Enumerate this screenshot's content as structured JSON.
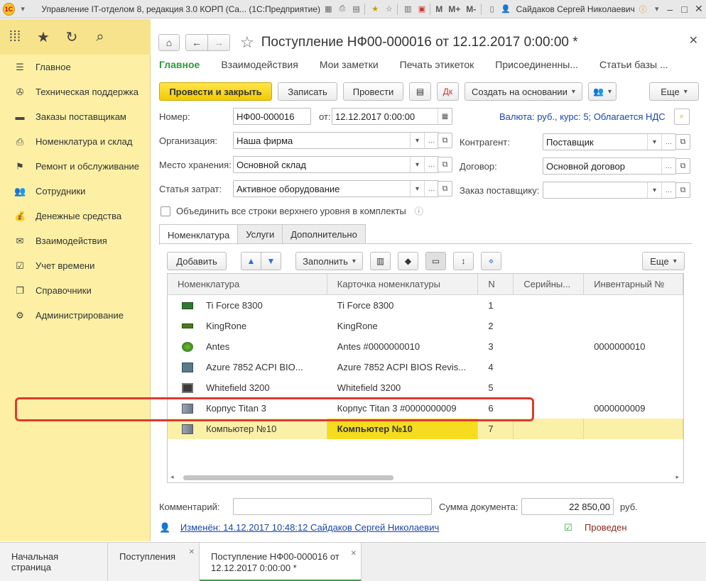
{
  "titlebar": {
    "title": "Управление IT-отделом 8, редакция 3.0 КОРП (Са... (1С:Предприятие)",
    "m_buttons": [
      "M",
      "M+",
      "M-"
    ],
    "user": "Сайдаков Сергей Николаевич"
  },
  "sidebar": {
    "items": [
      {
        "label": "Главное",
        "icon": "menu-icon"
      },
      {
        "label": "Техническая поддержка",
        "icon": "support-icon"
      },
      {
        "label": "Заказы поставщикам",
        "icon": "orders-icon"
      },
      {
        "label": "Номенклатура и склад",
        "icon": "printer-icon"
      },
      {
        "label": "Ремонт и обслуживание",
        "icon": "repair-icon"
      },
      {
        "label": "Сотрудники",
        "icon": "users-icon"
      },
      {
        "label": "Денежные средства",
        "icon": "money-icon"
      },
      {
        "label": "Взаимодействия",
        "icon": "mail-icon"
      },
      {
        "label": "Учет времени",
        "icon": "checklist-icon"
      },
      {
        "label": "Справочники",
        "icon": "books-icon"
      },
      {
        "label": "Администрирование",
        "icon": "gear-icon"
      }
    ]
  },
  "form": {
    "title": "Поступление НФ00-000016 от 12.12.2017 0:00:00 *",
    "tabs": [
      "Главное",
      "Взаимодействия",
      "Мои заметки",
      "Печать этикеток",
      "Присоединенны...",
      "Статьи базы ..."
    ],
    "commands": {
      "post_close": "Провести и закрыть",
      "save": "Записать",
      "post": "Провести",
      "create_based": "Создать на основании",
      "more": "Еще"
    },
    "fields": {
      "number_label": "Номер:",
      "number": "НФ00-000016",
      "date_label": "от:",
      "date": "12.12.2017  0:00:00",
      "currency_info": "Валюта: руб., курс: 5; Облагается НДС",
      "org_label": "Организация:",
      "org": "Наша фирма",
      "storage_label": "Место хранения:",
      "storage": "Основной склад",
      "cost_label": "Статья затрат:",
      "cost": "Активное оборудование",
      "counterparty_label": "Контрагент:",
      "counterparty": "Поставщик",
      "contract_label": "Договор:",
      "contract": "Основной договор",
      "order_label": "Заказ поставщику:",
      "order": ""
    },
    "combine_checkbox": "Объединить все строки верхнего уровня в комплекты",
    "form_tabs": [
      "Номенклатура",
      "Услуги",
      "Дополнительно"
    ],
    "table_bar": {
      "add": "Добавить",
      "fill": "Заполнить",
      "more": "Еще"
    },
    "table": {
      "columns": [
        "Номенклатура",
        "Карточка номенклатуры",
        "N",
        "Серийны...",
        "Инвентарный №"
      ],
      "rows": [
        {
          "icon": "gpu-icon",
          "name": "Ti Force 8300",
          "card": "Ti Force 8300",
          "n": "1",
          "serial": "",
          "inv": ""
        },
        {
          "icon": "ram-icon",
          "name": "KingRone",
          "card": "KingRone",
          "n": "2",
          "serial": "",
          "inv": ""
        },
        {
          "icon": "network-icon",
          "name": "Antes",
          "card": "Antes #0000000010",
          "n": "3",
          "serial": "",
          "inv": "0000000010"
        },
        {
          "icon": "motherboard-icon",
          "name": "Azure 7852 ACPI BIO...",
          "card": "Azure 7852 ACPI BIOS Revis...",
          "n": "4",
          "serial": "",
          "inv": ""
        },
        {
          "icon": "cpu-icon",
          "name": "Whitefield 3200",
          "card": "Whitefield 3200",
          "n": "5",
          "serial": "",
          "inv": ""
        },
        {
          "icon": "case-icon",
          "name": "Корпус Titan 3",
          "card": "Корпус Titan 3 #0000000009",
          "n": "6",
          "serial": "",
          "inv": "0000000009"
        },
        {
          "icon": "computer-icon",
          "name": "Компьютер №10",
          "card": "Компьютер №10",
          "n": "7",
          "serial": "",
          "inv": ""
        }
      ],
      "selected_row": 6
    },
    "comment_label": "Комментарий:",
    "comment": "",
    "sum_label": "Сумма документа:",
    "sum": "22 850,00",
    "sum_currency": "руб.",
    "changed": "Изменён: 14.12.2017 10:48:12 Сайдаков Сергей Николаевич",
    "status": "Проведен"
  },
  "taskbar": {
    "tabs": [
      {
        "label": "Начальная страница"
      },
      {
        "label": "Поступления"
      },
      {
        "label": "Поступление НФ00-000016 от 12.12.2017 0:00:00 *"
      }
    ]
  }
}
